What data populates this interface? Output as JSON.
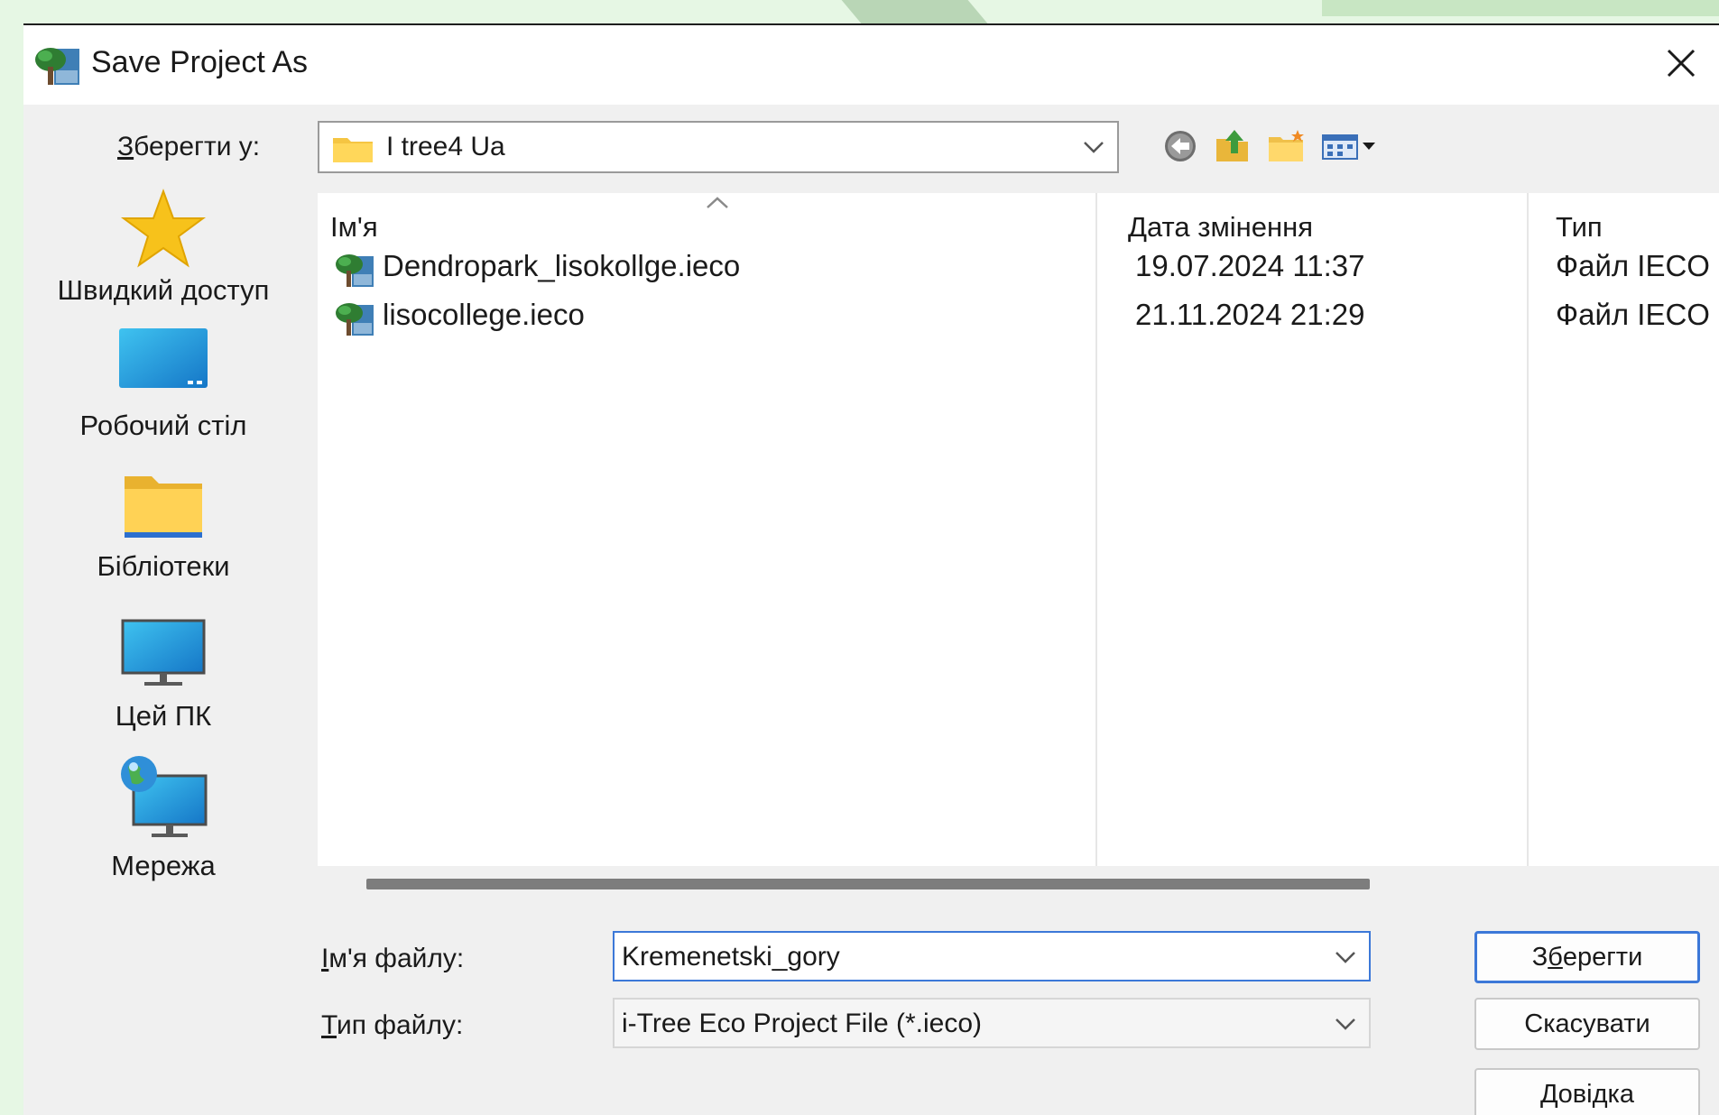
{
  "dialog": {
    "title": "Save Project As",
    "close_icon": "close-icon",
    "app_icon": "tree-icon"
  },
  "save_in": {
    "label_accel": "З",
    "label_rest": "берегти у:",
    "value": "I tree4 Ua"
  },
  "places": [
    {
      "label": "Швидкий доступ",
      "icon": "star-icon"
    },
    {
      "label": "Робочий стіл",
      "icon": "desktop-icon"
    },
    {
      "label": "Бібліотеки",
      "icon": "folder-icon"
    },
    {
      "label": "Цей ПК",
      "icon": "monitor-icon"
    },
    {
      "label": "Мережа",
      "icon": "network-icon"
    }
  ],
  "file_list": {
    "columns": [
      "Ім'я",
      "Дата змінення",
      "Тип"
    ],
    "rows": [
      {
        "name": "Dendropark_lisokollge.ieco",
        "date": "19.07.2024 11:37",
        "type": "Файл IECO"
      },
      {
        "name": "lisocollege.ieco",
        "date": "21.11.2024 21:29",
        "type": "Файл IECO"
      }
    ]
  },
  "file_name": {
    "label_accel": "І",
    "label_rest": "м'я файлу:",
    "value": "Kremenetski_gory"
  },
  "file_type": {
    "label_accel": "Т",
    "label_rest": "ип файлу:",
    "value": "i-Tree Eco Project File (*.ieco)"
  },
  "buttons": {
    "save_pre": "З",
    "save_accel": "б",
    "save_post": "ерегти",
    "cancel": "Скасувати",
    "help_accel": "Д",
    "help_rest": "овідка"
  },
  "colors": {
    "focus_border": "#3c78d8",
    "slide_background": "#e6f7e4",
    "folder_yellow": "#f5c542"
  }
}
